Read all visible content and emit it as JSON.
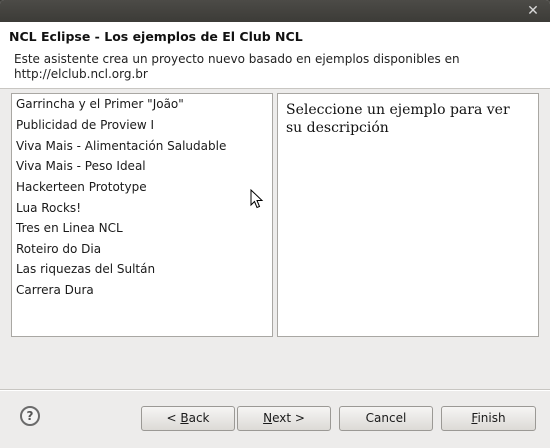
{
  "window": {
    "close_glyph": "✕"
  },
  "banner": {
    "title": "NCL Eclipse - Los ejemplos de El Club NCL",
    "description": "Este asistente crea un proyecto nuevo basado en ejemplos disponibles en http://elclub.ncl.org.br"
  },
  "examples": {
    "items": [
      "Garrincha y el Primer \"João\"",
      "Publicidad de Proview I",
      "Viva Mais - Alimentación Saludable",
      "Viva Mais - Peso Ideal",
      "Hackerteen Prototype",
      "Lua Rocks!",
      "Tres en Linea NCL",
      "Roteiro do Dia",
      "Las riquezas del Sultán",
      "Carrera Dura"
    ]
  },
  "description_panel": {
    "text": "Seleccione un ejemplo para ver su descripción"
  },
  "footer": {
    "help_icon": "?",
    "back": {
      "pre": "< ",
      "key": "B",
      "post": "ack"
    },
    "next": {
      "pre": "",
      "key": "N",
      "post": "ext >"
    },
    "cancel": "Cancel",
    "finish": {
      "pre": "",
      "key": "F",
      "post": "inish"
    }
  }
}
